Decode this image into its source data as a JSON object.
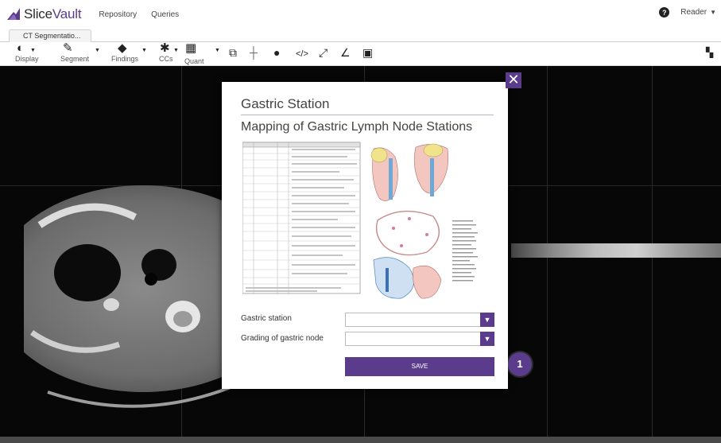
{
  "app": {
    "brand": "SliceVault",
    "brand_part1": "Slice",
    "brand_part2": "Vault",
    "nav": [
      "Repository",
      "Queries"
    ],
    "user_label": "Reader",
    "accent": "#5b3c8c"
  },
  "tabs": [
    {
      "label": "CT Segmentatio..."
    }
  ],
  "toolbar": {
    "tools": [
      {
        "label": "Display",
        "icon": "contrast-icon"
      },
      {
        "label": "Segment",
        "icon": "brush-icon"
      },
      {
        "label": "Findings",
        "icon": "tag-icon"
      },
      {
        "label": "CCs",
        "icon": "puzzle-icon"
      },
      {
        "label": "Quant",
        "icon": "chart-icon"
      }
    ],
    "icons": [
      "copy-icon",
      "crosshair-icon",
      "compass-icon",
      "code-icon",
      "expand-icon",
      "angle-icon",
      "cube-icon"
    ],
    "right_icon": "layout-icon"
  },
  "modal": {
    "title": "Gastric Station",
    "subtitle": "Mapping of Gastric Lymph Node Stations",
    "fields": [
      {
        "label": "Gastric station",
        "value": ""
      },
      {
        "label": "Grading of gastric node",
        "value": ""
      }
    ],
    "save_label": "SAVE",
    "close_glyph": "✕"
  },
  "step_badge": "1"
}
